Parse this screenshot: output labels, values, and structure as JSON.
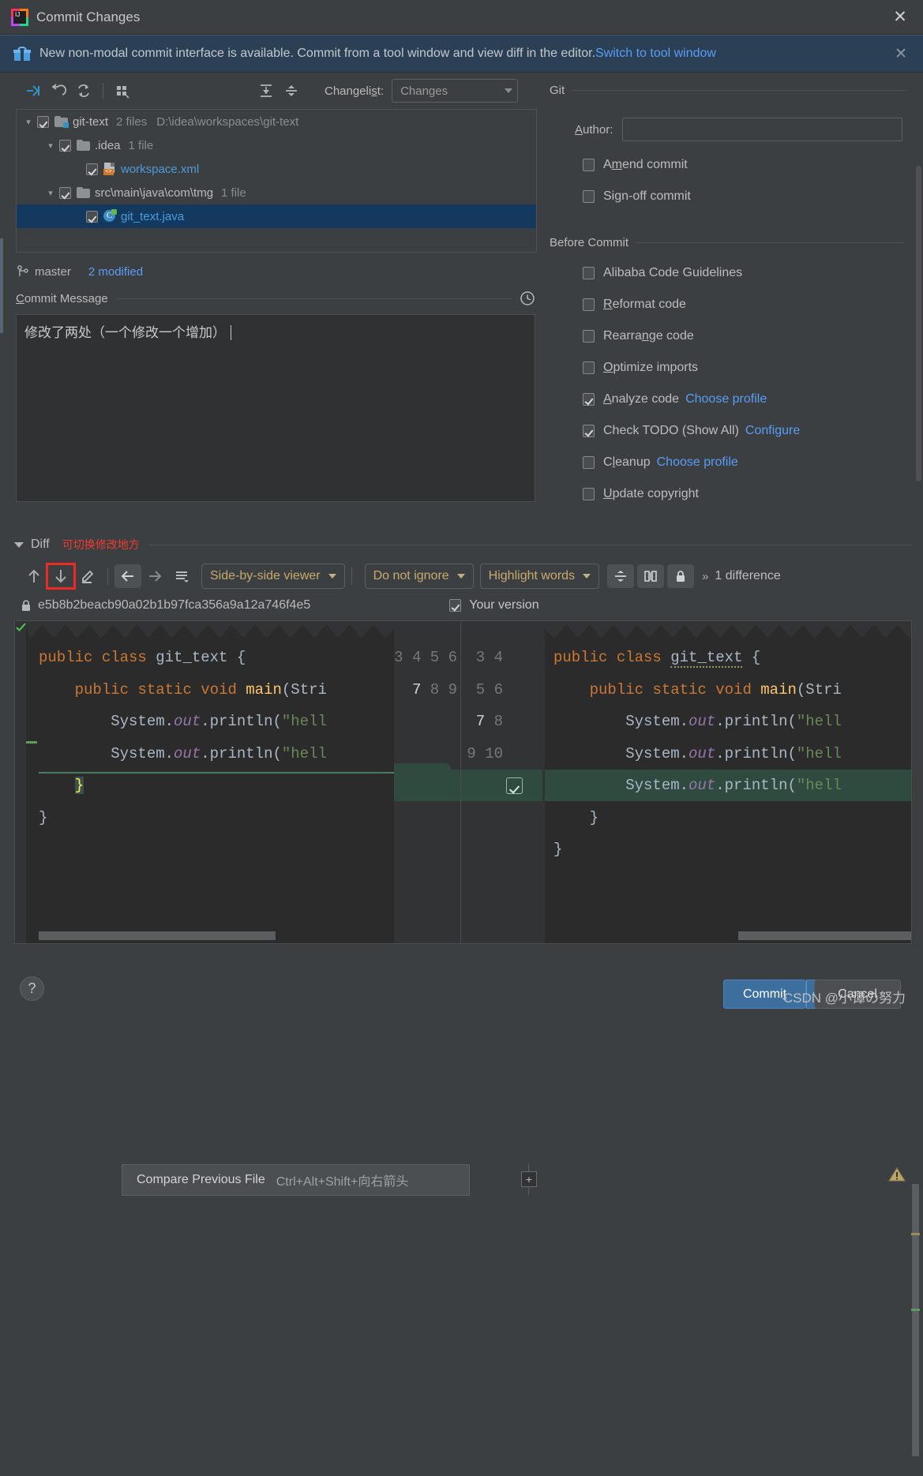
{
  "window": {
    "title": "Commit Changes",
    "app_icon": "intellij-idea-icon",
    "close_label": "✕"
  },
  "notification": {
    "icon": "gift-icon",
    "text": "New non-modal commit interface is available. Commit from a tool window and view diff in the editor.",
    "link": "Switch to tool window",
    "close_label": "✕"
  },
  "toolbar": {
    "icons": [
      {
        "name": "show-diff-icon",
        "title": "Show Diff"
      },
      {
        "name": "rollback-icon",
        "title": "Rollback"
      },
      {
        "name": "refresh-icon",
        "title": "Refresh Changes"
      },
      {
        "name": "group-by-icon",
        "title": "Group By"
      },
      {
        "name": "expand-all-icon",
        "title": "Expand All"
      },
      {
        "name": "collapse-all-icon",
        "title": "Collapse All"
      }
    ],
    "changelist_label": "Changelist:",
    "changelist_mnemonic": "s",
    "changelist_value": "Changes"
  },
  "file_tree": [
    {
      "name": "git-text",
      "count": "2 files",
      "path": "D:\\idea\\workspaces\\git-text",
      "icon": "folder-modified-icon",
      "checked": true,
      "expanded": true,
      "indent": 0,
      "selected": false,
      "link": false
    },
    {
      "name": ".idea",
      "count": "1 file",
      "path": "",
      "icon": "folder-icon",
      "checked": true,
      "expanded": true,
      "indent": 1,
      "selected": false,
      "link": false
    },
    {
      "name": "workspace.xml",
      "count": "",
      "path": "",
      "icon": "xml-file-icon",
      "checked": true,
      "expanded": null,
      "indent": 2,
      "selected": false,
      "link": true
    },
    {
      "name": "src\\main\\java\\com\\tmg",
      "count": "1 file",
      "path": "",
      "icon": "folder-icon",
      "checked": true,
      "expanded": true,
      "indent": 1,
      "selected": false,
      "link": false
    },
    {
      "name": "git_text.java",
      "count": "",
      "path": "",
      "icon": "java-class-icon",
      "checked": true,
      "expanded": null,
      "indent": 2,
      "selected": true,
      "link": true
    }
  ],
  "branch": {
    "icon": "git-branch-icon",
    "name": "master",
    "modified": "2 modified"
  },
  "commit_message": {
    "title": "Commit Message",
    "mnemonic": "C",
    "value": "修改了两处（一个修改一个增加）",
    "history_icon": "clock-icon"
  },
  "git_panel": {
    "section_title": "Git",
    "author_label": "Author:",
    "author_mnemonic": "A",
    "author_value": "",
    "options": [
      {
        "label": "Amend commit",
        "mnemonic": "m",
        "checked": false
      },
      {
        "label": "Sign-off commit",
        "mnemonic": "g",
        "checked": false
      }
    ]
  },
  "before_commit": {
    "section_title": "Before Commit",
    "options": [
      {
        "label": "Alibaba Code Guidelines",
        "mnemonic": "",
        "checked": false,
        "link": ""
      },
      {
        "label": "Reformat code",
        "mnemonic": "R",
        "checked": false,
        "link": ""
      },
      {
        "label": "Rearrange code",
        "mnemonic": "n",
        "checked": false,
        "link": ""
      },
      {
        "label": "Optimize imports",
        "mnemonic": "O",
        "checked": false,
        "link": ""
      },
      {
        "label": "Analyze code",
        "mnemonic": "A",
        "checked": true,
        "link": "Choose profile"
      },
      {
        "label": "Check TODO (Show All)",
        "mnemonic": "",
        "checked": true,
        "link": "Configure"
      },
      {
        "label": "Cleanup",
        "mnemonic": "l",
        "checked": false,
        "link": "Choose profile"
      },
      {
        "label": "Update copyright",
        "mnemonic": "U",
        "checked": false,
        "link": ""
      }
    ]
  },
  "diff": {
    "section_title": "Diff",
    "annotation": "可切换修改地方",
    "annotation_color": "#ef3b2f",
    "buttons": [
      {
        "name": "previous-difference-icon",
        "title": "Previous Difference",
        "highlighted": false
      },
      {
        "name": "next-difference-icon",
        "title": "Next Difference",
        "highlighted": true
      },
      {
        "name": "annotate-icon",
        "title": "Annotate",
        "highlighted": false
      },
      {
        "name": "compare-previous-file-icon",
        "title": "Compare Previous File",
        "highlighted": false
      },
      {
        "name": "compare-next-file-icon",
        "title": "Compare Next File",
        "highlighted": false
      },
      {
        "name": "diff-settings-icon",
        "title": "Settings",
        "highlighted": false
      }
    ],
    "viewer_mode": "Side-by-side viewer",
    "ignore_mode": "Do not ignore",
    "highlight_mode": "Highlight words",
    "icon_buttons": [
      {
        "name": "collapse-unchanged-icon",
        "title": "Collapse unchanged fragments"
      },
      {
        "name": "synchronize-scrolling-icon",
        "title": "Synchronize scrolling"
      },
      {
        "name": "read-only-lock-icon",
        "title": "Read-only"
      }
    ],
    "more_label": "»",
    "difference_count": "1 difference",
    "left_version_hash": "e5b8b2beacb90a02b1b97fca356a9a12a746f4e5",
    "left_lock_icon": "lock-icon",
    "right_version_label": "Your version",
    "right_version_checked": true,
    "expand_fold_label": "+",
    "warning_icon": "warning-triangle-icon",
    "ok_icon": "inspection-ok-icon"
  },
  "tooltip": {
    "action": "Compare Previous File",
    "shortcut": "Ctrl+Alt+Shift+向右箭头"
  },
  "code_left": {
    "lines": [
      {
        "num": "3",
        "text": "public class git_text {"
      },
      {
        "num": "4",
        "text": "    public static void main(Stri"
      },
      {
        "num": "5",
        "text": "        System.out.println(\"hell"
      },
      {
        "num": "6",
        "text": "        System.out.println(\"hell"
      },
      {
        "num": "7",
        "text": "    }"
      },
      {
        "num": "8",
        "text": "}"
      },
      {
        "num": "9",
        "text": ""
      }
    ]
  },
  "code_right": {
    "lines": [
      {
        "num": "3",
        "text": "public class git_text {"
      },
      {
        "num": "4",
        "text": "    public static void main(Stri"
      },
      {
        "num": "5",
        "text": "        System.out.println(\"hell"
      },
      {
        "num": "6",
        "text": "        System.out.println(\"hell"
      },
      {
        "num": "7",
        "text": "        System.out.println(\"hell",
        "added": true
      },
      {
        "num": "8",
        "text": "    }"
      },
      {
        "num": "9",
        "text": "}"
      },
      {
        "num": "10",
        "text": ""
      }
    ]
  },
  "footer": {
    "help_label": "?",
    "commit_label": "Commit",
    "commit_mnemonic": "t",
    "cancel_label": "Cancel",
    "watermark": "CSDN @小谭の努力"
  },
  "colors": {
    "accent": "#589df6",
    "commit_button": "#3c6e9e",
    "annotation": "#ef3b2f",
    "added_line": "#2f4b3f",
    "notification_bg": "#2c4055",
    "selection": "#133a5e"
  }
}
